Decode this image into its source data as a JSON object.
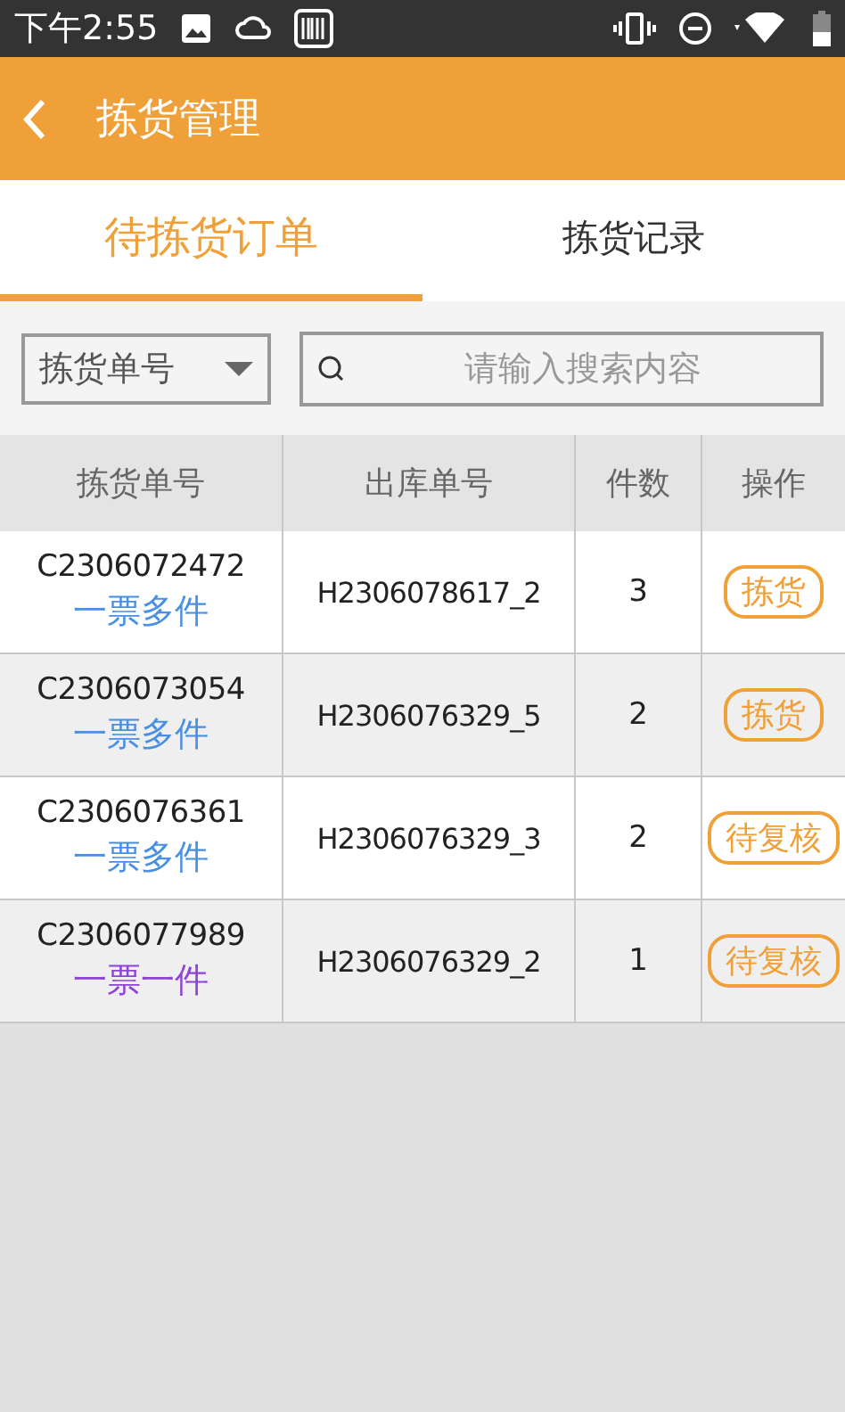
{
  "status_bar": {
    "time": "下午2:55"
  },
  "app_bar": {
    "title": "拣货管理"
  },
  "tabs": [
    {
      "label": "待拣货订单",
      "selected": true
    },
    {
      "label": "拣货记录",
      "selected": false
    }
  ],
  "filter": {
    "dropdown": "拣货单号",
    "placeholder": "请输入搜索内容"
  },
  "table": {
    "columns": [
      "拣货单号",
      "出库单号",
      "件数",
      "操作"
    ],
    "rows": [
      {
        "pick_no": "C2306072472",
        "tag": {
          "text": "一票多件",
          "color": "#4a90e2"
        },
        "out_no": "H2306078617_2",
        "qty": "3",
        "action": "拣货"
      },
      {
        "pick_no": "C2306073054",
        "tag": {
          "text": "一票多件",
          "color": "#4a90e2"
        },
        "out_no": "H2306076329_5",
        "qty": "2",
        "action": "拣货"
      },
      {
        "pick_no": "C2306076361",
        "tag": {
          "text": "一票多件",
          "color": "#4a90e2"
        },
        "out_no": "H2306076329_3",
        "qty": "2",
        "action": "待复核"
      },
      {
        "pick_no": "C2306077989",
        "tag": {
          "text": "一票一件",
          "color": "#8e44d8"
        },
        "out_no": "H2306076329_2",
        "qty": "1",
        "action": "待复核"
      }
    ]
  }
}
